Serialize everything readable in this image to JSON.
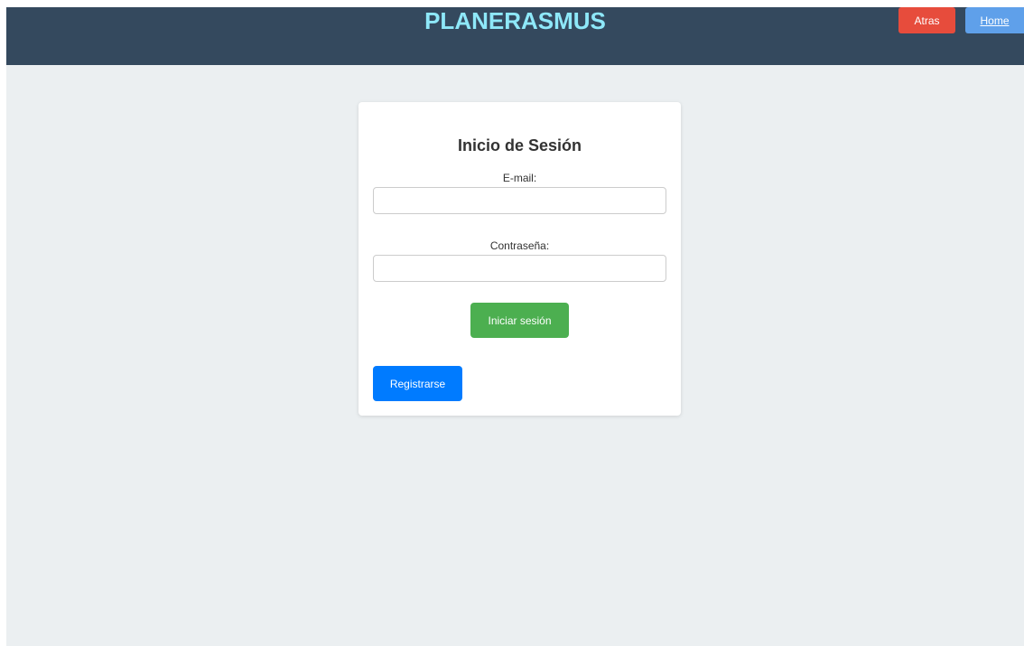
{
  "header": {
    "brand": "PLANERASMUS",
    "back_label": "Atras",
    "home_label": "Home"
  },
  "login": {
    "title": "Inicio de Sesión",
    "email_label": "E-mail:",
    "email_value": "",
    "password_label": "Contraseña:",
    "password_value": "",
    "submit_label": "Iniciar sesión",
    "register_label": "Registrarse"
  },
  "colors": {
    "header_bg": "#34495e",
    "brand_text": "#8ee8f9",
    "page_bg": "#ebeff1",
    "back_button": "#e74c3c",
    "home_button": "#5fa0ea",
    "login_button": "#4caf50",
    "register_button": "#007bff"
  }
}
